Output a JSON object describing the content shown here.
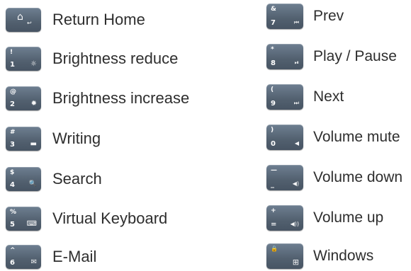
{
  "left": [
    {
      "label": "Return Home",
      "top": "",
      "bottom": "",
      "icon": "home-icon",
      "glyph": "⌂",
      "extra": "↩"
    },
    {
      "label": "Brightness reduce",
      "top": "!",
      "bottom": "1",
      "icon": "brightness-low-icon",
      "glyph": "☼"
    },
    {
      "label": "Brightness increase",
      "top": "@",
      "bottom": "2",
      "icon": "brightness-high-icon",
      "glyph": "✹"
    },
    {
      "label": "Writing",
      "top": "#",
      "bottom": "3",
      "icon": "writing-icon",
      "glyph": "▬"
    },
    {
      "label": "Search",
      "top": "$",
      "bottom": "4",
      "icon": "search-icon",
      "glyph": "🔍"
    },
    {
      "label": "Virtual Keyboard",
      "top": "%",
      "bottom": "5",
      "icon": "keyboard-icon",
      "glyph": "⌨"
    },
    {
      "label": "E-Mail",
      "top": "^",
      "bottom": "6",
      "icon": "mail-icon",
      "glyph": "✉"
    }
  ],
  "right": [
    {
      "label": "Prev",
      "top": "&",
      "bottom": "7",
      "icon": "previous-track-icon",
      "glyph": "⏮"
    },
    {
      "label": "Play / Pause",
      "top": "*",
      "bottom": "8",
      "icon": "play-pause-icon",
      "glyph": "⏯"
    },
    {
      "label": "Next",
      "top": "(",
      "bottom": "9",
      "icon": "next-track-icon",
      "glyph": "⏭"
    },
    {
      "label": "Volume mute",
      "top": ")",
      "bottom": "0",
      "icon": "volume-mute-icon",
      "glyph": "◀"
    },
    {
      "label": "Volume down",
      "top": "—",
      "bottom": "_",
      "icon": "volume-down-icon",
      "glyph": "◀)"
    },
    {
      "label": "Volume up",
      "top": "+",
      "bottom": "=",
      "icon": "volume-up-icon",
      "glyph": "◀))"
    },
    {
      "label": "Windows",
      "top": "🔒",
      "bottom": "",
      "icon": "windows-icon",
      "glyph": "⊞"
    }
  ],
  "colors": {
    "key": "#56646f",
    "text": "#2e2e2e",
    "background": "#ffffff"
  }
}
